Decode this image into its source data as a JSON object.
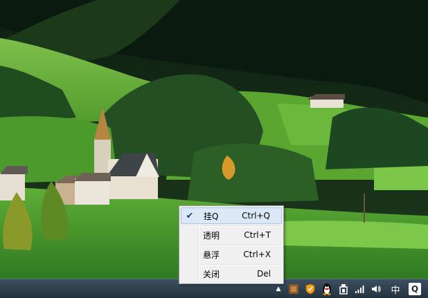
{
  "context_menu": {
    "items": [
      {
        "label": "挂Q",
        "shortcut": "Ctrl+Q",
        "checked": true
      },
      {
        "label": "透明",
        "shortcut": "Ctrl+T",
        "checked": false
      },
      {
        "label": "悬浮",
        "shortcut": "Ctrl+X",
        "checked": false
      },
      {
        "label": "关闭",
        "shortcut": "Del",
        "checked": false
      }
    ],
    "check_glyph": "✔"
  },
  "taskbar": {
    "tray_icons": [
      "show-hidden-icons-arrow-icon",
      "app-tray-icon",
      "shield-icon",
      "qq-penguin-icon",
      "usb-device-icon",
      "network-signal-icon",
      "volume-icon"
    ],
    "overflow_arrow": "▲",
    "input_language": "中",
    "q_badge": "Q"
  },
  "colors": {
    "taskbar_top": "#3d5060",
    "taskbar_bottom": "#24333f",
    "menu_background": "#f0f0f0",
    "menu_highlight": "#dce8f5",
    "menu_highlight_border": "#a8c6e8"
  }
}
